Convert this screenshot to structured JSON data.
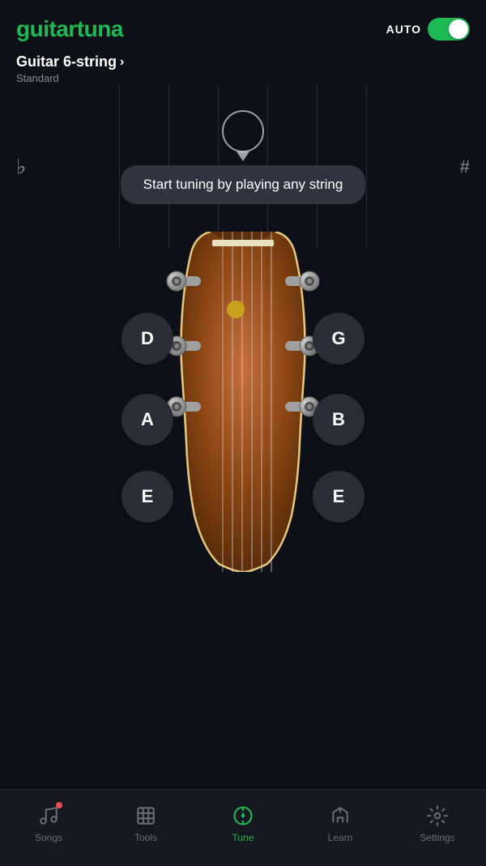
{
  "header": {
    "logo_guitar": "guitar",
    "logo_tuna": "tuna",
    "auto_label": "AUTO",
    "toggle_on": true
  },
  "instrument": {
    "name": "Guitar 6-string",
    "chevron": "›",
    "tuning": "Standard"
  },
  "tuner": {
    "flat_symbol": "♭",
    "sharp_symbol": "#",
    "tooltip_text": "Start tuning by playing any string"
  },
  "strings": {
    "left": [
      "D",
      "A",
      "E"
    ],
    "right": [
      "G",
      "B",
      "E"
    ]
  },
  "nav": {
    "items": [
      {
        "id": "songs",
        "label": "Songs",
        "active": false,
        "dot": true
      },
      {
        "id": "tools",
        "label": "Tools",
        "active": false,
        "dot": false
      },
      {
        "id": "tune",
        "label": "Tune",
        "active": true,
        "dot": false
      },
      {
        "id": "learn",
        "label": "Learn",
        "active": false,
        "dot": false
      },
      {
        "id": "settings",
        "label": "Settings",
        "active": false,
        "dot": false
      }
    ]
  }
}
